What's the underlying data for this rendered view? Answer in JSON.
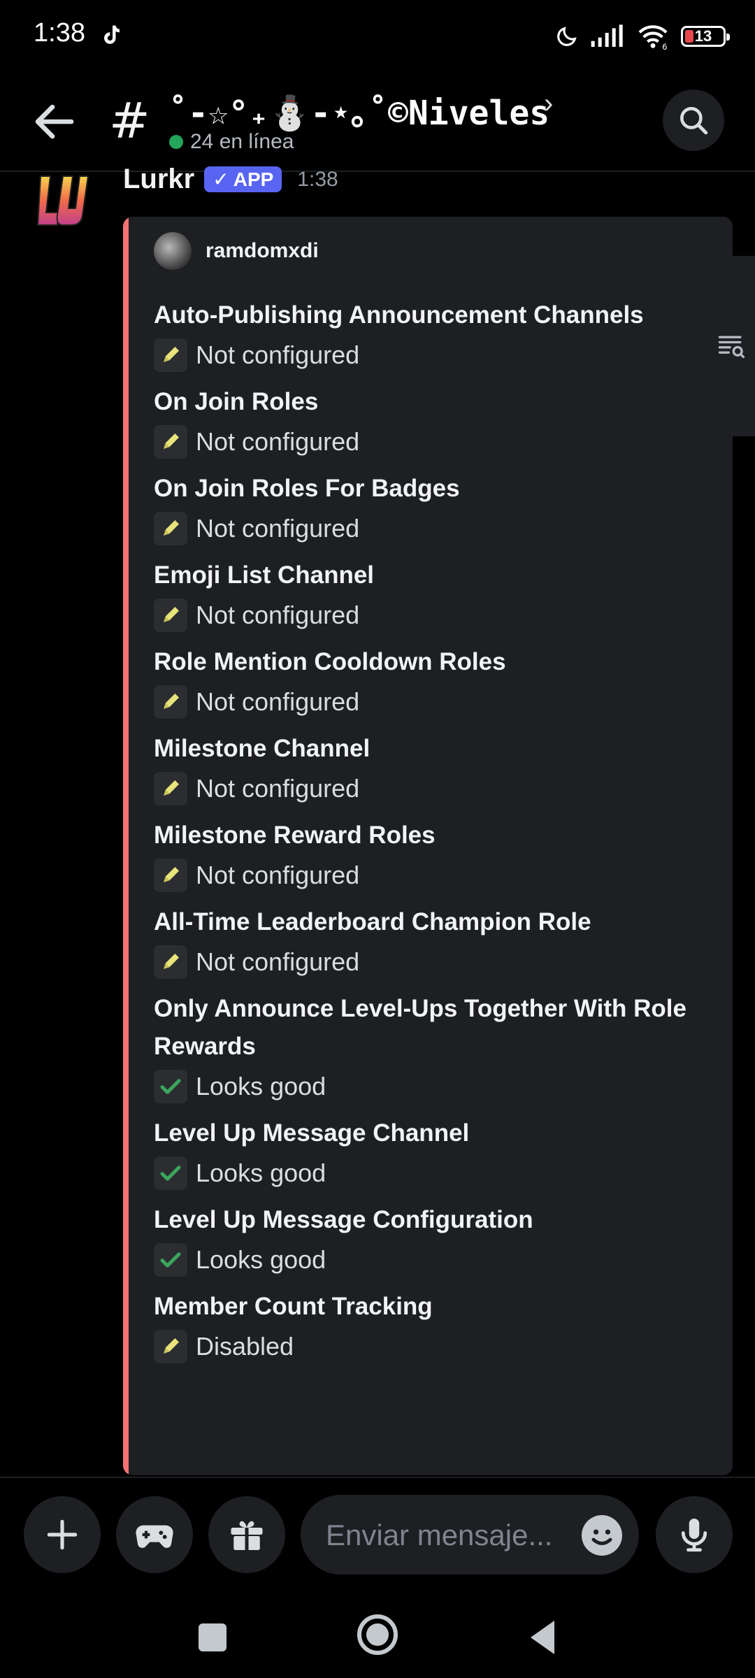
{
  "status_bar": {
    "time": "1:38",
    "battery": "13"
  },
  "header": {
    "channel_name": "˚-☆°₊⛄-⋆｡˚©Niveles",
    "online": "24 en línea"
  },
  "message": {
    "author": "Lurkr",
    "badge": "APP",
    "timestamp": "1:38",
    "embed": {
      "author": "ramdomxdi",
      "fields": [
        {
          "name": "Auto-Publishing Announcement Channels",
          "status": "pencil",
          "value": "Not configured"
        },
        {
          "name": "On Join Roles",
          "status": "pencil",
          "value": "Not configured"
        },
        {
          "name": "On Join Roles For Badges",
          "status": "pencil",
          "value": "Not configured"
        },
        {
          "name": "Emoji List Channel",
          "status": "pencil",
          "value": "Not configured"
        },
        {
          "name": "Role Mention Cooldown Roles",
          "status": "pencil",
          "value": "Not configured"
        },
        {
          "name": "Milestone Channel",
          "status": "pencil",
          "value": "Not configured"
        },
        {
          "name": "Milestone Reward Roles",
          "status": "pencil",
          "value": "Not configured"
        },
        {
          "name": "All-Time Leaderboard Champion Role",
          "status": "pencil",
          "value": "Not configured"
        },
        {
          "name": "Only Announce Level-Ups Together With Role Rewards",
          "status": "check",
          "value": "Looks good"
        },
        {
          "name": "Level Up Message Channel",
          "status": "check",
          "value": "Looks good"
        },
        {
          "name": "Level Up Message Configuration",
          "status": "check",
          "value": "Looks good"
        },
        {
          "name": "Member Count Tracking",
          "status": "pencil",
          "value": "Disabled"
        }
      ]
    }
  },
  "composer": {
    "placeholder": "Enviar mensaje..."
  },
  "colors": {
    "accent": "#5865f2",
    "embed_bar": "#f47272",
    "online": "#23a55a",
    "check": "#3ba55d",
    "pencil": "#e8e37a"
  }
}
